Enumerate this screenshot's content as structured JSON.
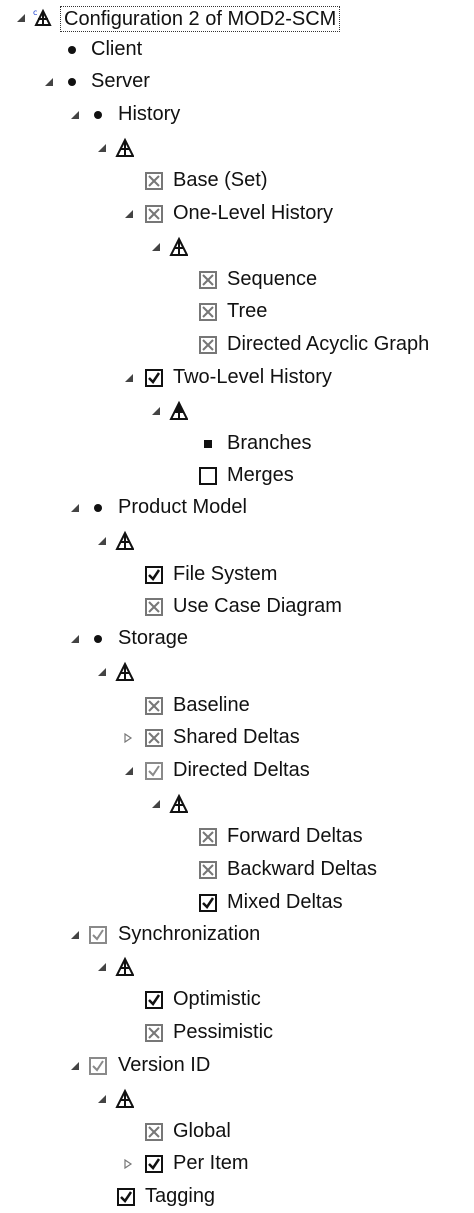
{
  "tree": {
    "root": "Configuration 2 of MOD2-SCM",
    "client": "Client",
    "server": "Server",
    "history": "History",
    "base_set": "Base (Set)",
    "one_level_history": "One-Level History",
    "sequence": "Sequence",
    "tree": "Tree",
    "dag": "Directed Acyclic Graph",
    "two_level_history": "Two-Level History",
    "branches": "Branches",
    "merges": "Merges",
    "product_model": "Product Model",
    "file_system": "File System",
    "use_case_diagram": "Use Case Diagram",
    "storage": "Storage",
    "baseline": "Baseline",
    "shared_deltas": "Shared Deltas",
    "directed_deltas": "Directed Deltas",
    "forward_deltas": "Forward Deltas",
    "backward_deltas": "Backward Deltas",
    "mixed_deltas": "Mixed Deltas",
    "synchronization": "Synchronization",
    "optimistic": "Optimistic",
    "pessimistic": "Pessimistic",
    "version_id": "Version ID",
    "global": "Global",
    "per_item": "Per Item",
    "tagging": "Tagging"
  },
  "icons": {
    "feature": "bullet-icon",
    "group": "alternative-group-icon",
    "checked": "checked-box-icon",
    "excluded": "crossed-box-icon",
    "unchecked": "empty-box-icon",
    "implied": "gray-check-icon",
    "expanded": "expanded-triangle-icon",
    "collapsed": "collapsed-triangle-icon"
  },
  "colors": {
    "text": "#111111",
    "gray": "#8a8a8a",
    "selection_border": "#333333"
  }
}
